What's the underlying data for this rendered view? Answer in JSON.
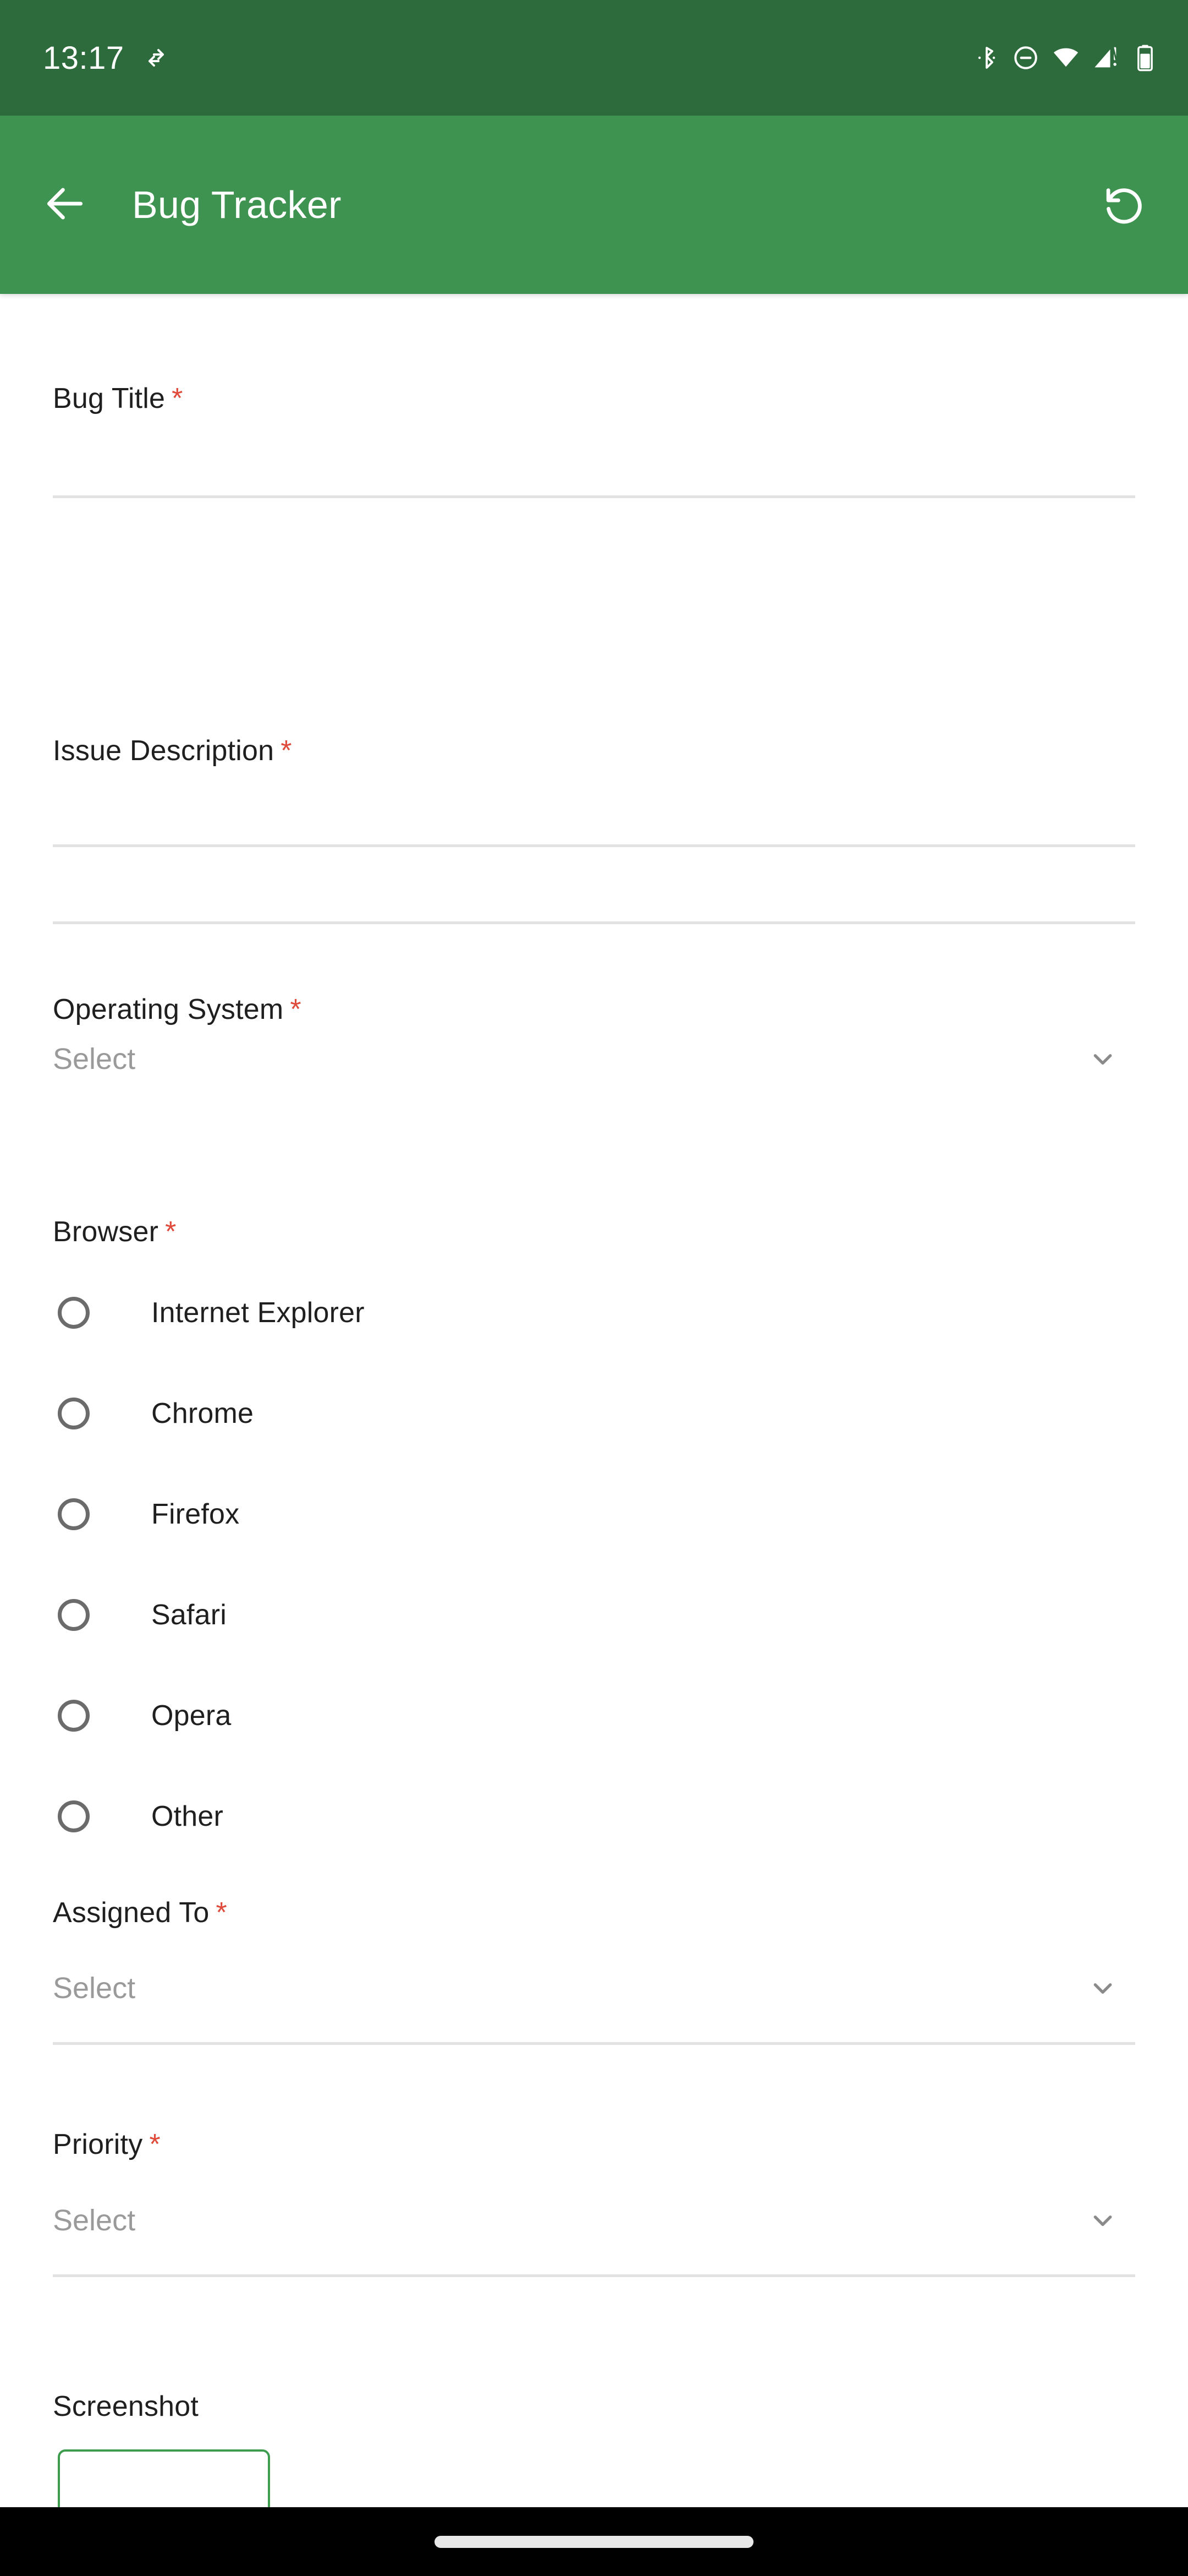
{
  "status_bar": {
    "time": "13:17",
    "icons": [
      {
        "name": "data-transfer-icon"
      },
      {
        "name": "bluetooth-icon"
      },
      {
        "name": "do-not-disturb-icon"
      },
      {
        "name": "wifi-icon"
      },
      {
        "name": "cellular-signal-no-sim-icon"
      },
      {
        "name": "battery-icon"
      }
    ],
    "background_color": "#2d6b3d"
  },
  "app_bar": {
    "title": "Bug Tracker",
    "back_icon": "arrow-left-icon",
    "action_icon": "restore-reset-icon",
    "background_color": "#3f9350",
    "text_color": "#ffffff"
  },
  "form": {
    "required_marker": "*",
    "required_marker_color": "#e04a3a",
    "fields": [
      {
        "id": "bug_title",
        "label": "Bug Title",
        "required": true,
        "type": "text",
        "value": "",
        "placeholder": ""
      },
      {
        "id": "issue_description",
        "label": "Issue Description",
        "required": true,
        "type": "textarea",
        "value": "",
        "placeholder": ""
      },
      {
        "id": "operating_system",
        "label": "Operating System",
        "required": true,
        "type": "dropdown",
        "value": "",
        "placeholder": "Select"
      },
      {
        "id": "browser",
        "label": "Browser",
        "required": true,
        "type": "radio-group",
        "value": "",
        "options": [
          "Internet Explorer",
          "Chrome",
          "Firefox",
          "Safari",
          "Opera",
          "Other"
        ]
      },
      {
        "id": "assigned_to",
        "label": "Assigned To",
        "required": true,
        "type": "dropdown",
        "value": "",
        "placeholder": "Select"
      },
      {
        "id": "priority",
        "label": "Priority",
        "required": true,
        "type": "dropdown",
        "value": "",
        "placeholder": "Select"
      },
      {
        "id": "screenshot",
        "label": "Screenshot",
        "required": false,
        "type": "file-button",
        "value": ""
      }
    ],
    "label_color": "#1f1f1f",
    "placeholder_color": "#9a9a9a",
    "underline_color": "#e2e2e2",
    "radio_border_color": "#6b6b6b",
    "accent_color": "#3d9c4e"
  },
  "nav_bar": {
    "gesture_pill": "home-gesture-pill",
    "background_color": "#000000"
  }
}
